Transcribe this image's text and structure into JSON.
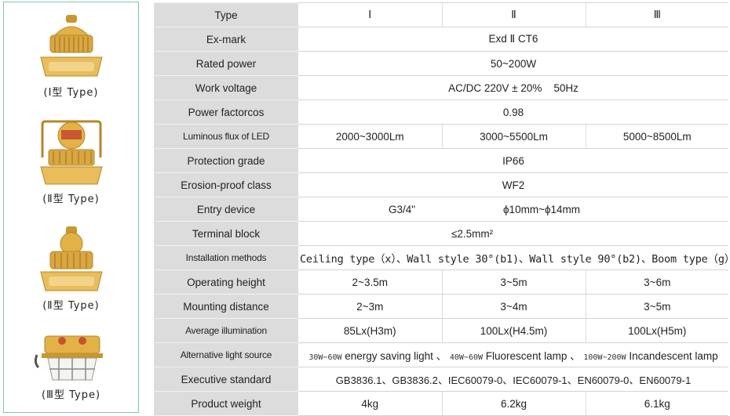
{
  "lamps": [
    {
      "caption": "(Ⅰ型 Type)",
      "icon": "lamp-type-1-icon"
    },
    {
      "caption": "(Ⅱ型 Type)",
      "icon": "lamp-type-2-icon"
    },
    {
      "caption": "(Ⅱ型 Type)",
      "icon": "lamp-type-2b-icon"
    },
    {
      "caption": "(Ⅲ型 Type)",
      "icon": "lamp-type-3-icon"
    }
  ],
  "table": {
    "type": {
      "label": "Type",
      "c1": "Ⅰ",
      "c2": "Ⅱ",
      "c3": "Ⅲ"
    },
    "exmark": {
      "label": "Ex-mark",
      "value": "Exd Ⅱ CT6"
    },
    "rated_power": {
      "label": "Rated power",
      "value": "50~200W"
    },
    "work_voltage": {
      "label": "Work voltage",
      "value": "AC/DC 220V ± 20%    50Hz"
    },
    "power_factor": {
      "label": "Power factorcos",
      "value": "0.98"
    },
    "luminous_flux": {
      "label": "Luminous flux of LED",
      "c1": "2000~3000Lm",
      "c2": "3000~5500Lm",
      "c3": "5000~8500Lm"
    },
    "protection": {
      "label": "Protection grade",
      "value": "IP66"
    },
    "erosion": {
      "label": "Erosion-proof class",
      "value": "WF2"
    },
    "entry": {
      "label": "Entry device",
      "c1": "G3/4\"",
      "c2": "ϕ10mm~ϕ14mm"
    },
    "terminal": {
      "label": "Terminal block",
      "value": "≤2.5mm²"
    },
    "installation": {
      "label": "Installation methods",
      "value": "Ceiling type（x）、Wall style 30°(b1)、Wall style 90°(b2)、Boom type（g）、Flange type（f）"
    },
    "operating_height": {
      "label": "Operating height",
      "c1": "2~3.5m",
      "c2": "3~5m",
      "c3": "3~6m"
    },
    "mounting_distance": {
      "label": "Mounting distance",
      "c1": "2~3m",
      "c2": "3~4m",
      "c3": "3~5m"
    },
    "illumination": {
      "label": "Average illumination",
      "c1": "85Lx(H3m)",
      "c2": "100Lx(H4.5m)",
      "c3": "100Lx(H5m)"
    },
    "alt_source": {
      "label": "Alternative light source",
      "p1": "30W~60W",
      "t1": "energy saving light 、",
      "p2": "40W~60W",
      "t2": "Fluorescent lamp 、",
      "p3": "100W~200W",
      "t3": "Incandescent lamp"
    },
    "standard": {
      "label": "Executive standard",
      "value": "GB3836.1、GB3836.2、IEC60079-0、IEC60079-1、EN60079-0、EN60079-1"
    },
    "weight": {
      "label": "Product weight",
      "c1": "4kg",
      "c2": "6.2kg",
      "c3": "6.1kg"
    }
  },
  "colors": {
    "label_bg": "#dcdcdc",
    "panel_border": "#7fc9a4",
    "lamp_body": "#e2b248"
  }
}
